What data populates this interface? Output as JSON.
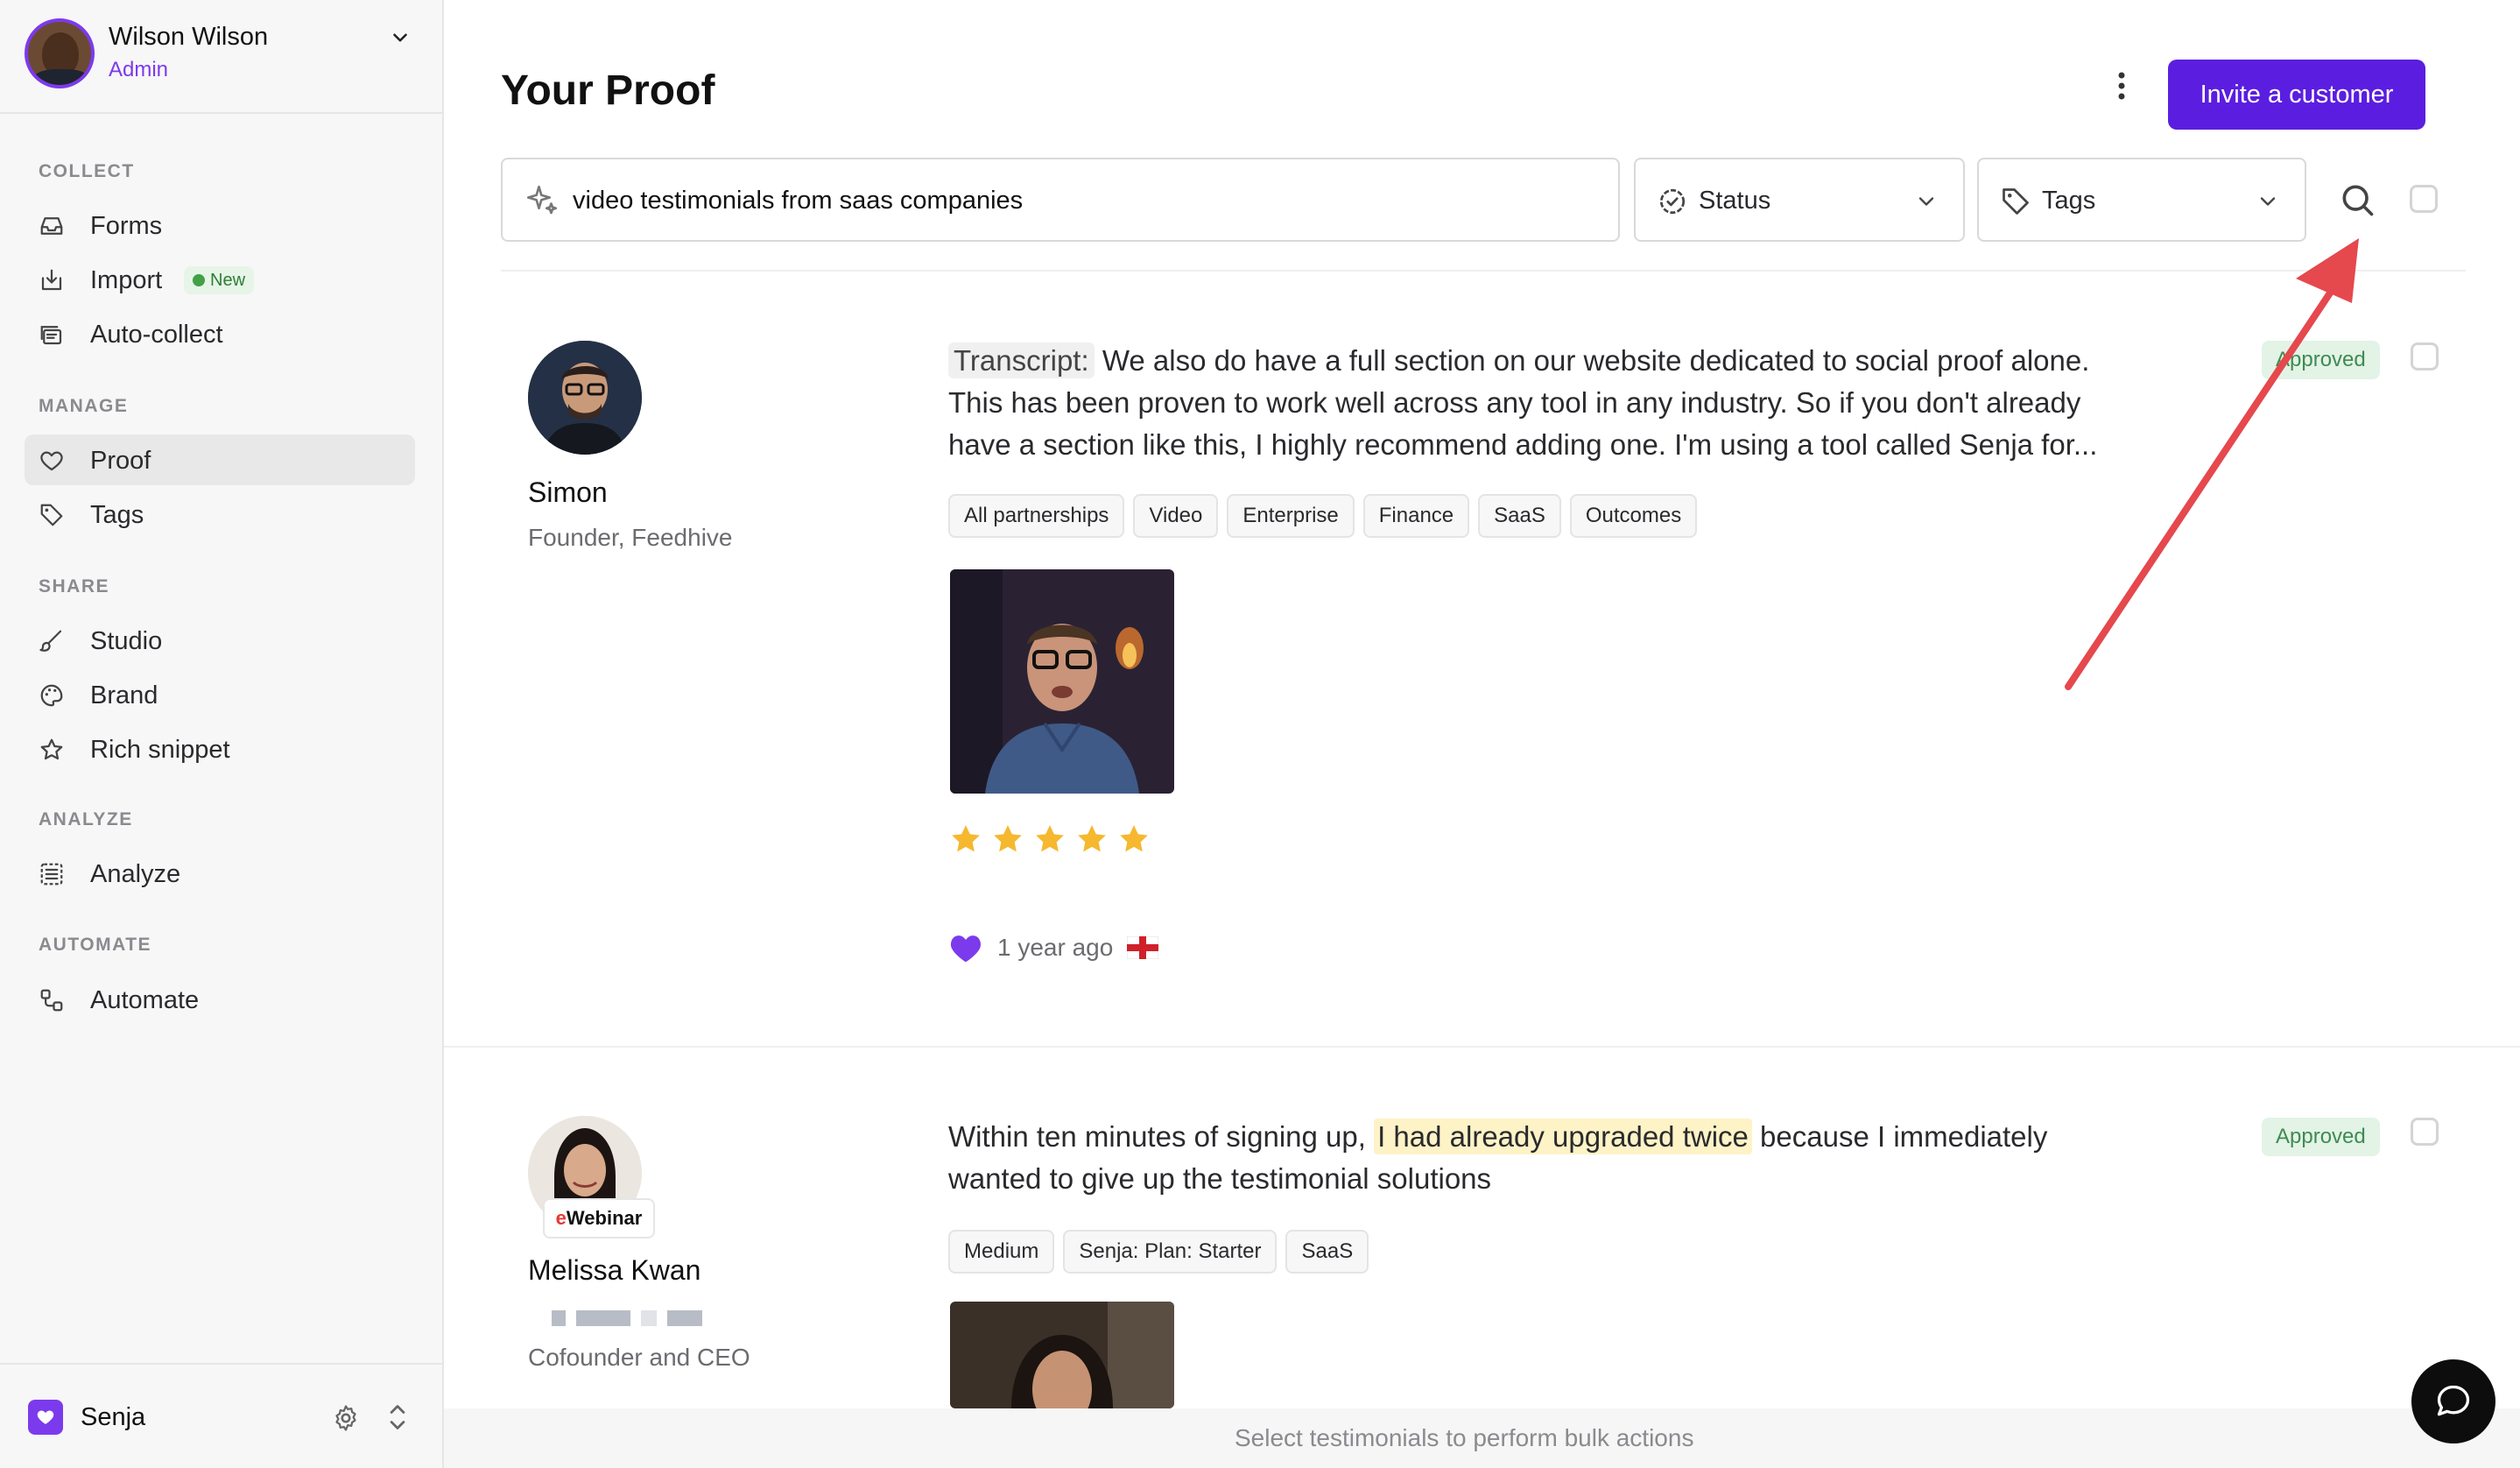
{
  "user": {
    "name": "Wilson Wilson",
    "role": "Admin"
  },
  "sidebar": {
    "sections": {
      "collect": "COLLECT",
      "manage": "MANAGE",
      "share": "SHARE",
      "analyze": "ANALYZE",
      "automate": "AUTOMATE"
    },
    "items": {
      "forms": "Forms",
      "import": "Import",
      "import_badge": "New",
      "autocollect": "Auto-collect",
      "proof": "Proof",
      "tags": "Tags",
      "studio": "Studio",
      "brand": "Brand",
      "rich_snippet": "Rich snippet",
      "analyze": "Analyze",
      "automate": "Automate"
    },
    "active_item": "Proof",
    "workspace": "Senja"
  },
  "header": {
    "title": "Your Proof",
    "invite_button": "Invite a customer"
  },
  "filters": {
    "search_value": "video testimonials from saas companies",
    "status_label": "Status",
    "tags_label": "Tags"
  },
  "testimonials": [
    {
      "name": "Simon",
      "title": "Founder, Feedhive",
      "transcript_label": "Transcript:",
      "text": "We also do have a full section on our website dedicated to social proof alone. This has been proven to work well across any tool in any industry. So if you don't already have a section like this, I highly recommend adding one. I'm using a tool called Senja for...",
      "tags": [
        "All partnerships",
        "Video",
        "Enterprise",
        "Finance",
        "SaaS",
        "Outcomes"
      ],
      "status": "Approved",
      "rating": 5,
      "time": "1 year ago"
    },
    {
      "name": "Melissa Kwan",
      "company_badge_prefix": "e",
      "company_badge": "Webinar",
      "title": "Cofounder and CEO",
      "text_before": "Within ten minutes of signing up,",
      "text_highlight": "I had already upgraded twice",
      "text_after": "because I immediately wanted to give up the testimonial solutions",
      "tags": [
        "Medium",
        "Senja: Plan: Starter",
        "SaaS"
      ],
      "status": "Approved"
    }
  ],
  "bulk_bar": {
    "text": "Select testimonials to perform bulk actions"
  },
  "colors": {
    "accent": "#5b1ee0",
    "approved_bg": "#e3f3e6",
    "approved_text": "#3f8b52",
    "annotation_arrow": "#e5484d",
    "star": "#f5b82e"
  },
  "icons": {
    "forms": "inbox-icon",
    "import": "import-icon",
    "autocollect": "stack-icon",
    "proof": "heart-icon",
    "tags": "tag-icon",
    "studio": "brush-icon",
    "brand": "palette-icon",
    "rich_snippet": "star-icon",
    "analyze": "grid-icon",
    "automate": "flow-icon"
  }
}
